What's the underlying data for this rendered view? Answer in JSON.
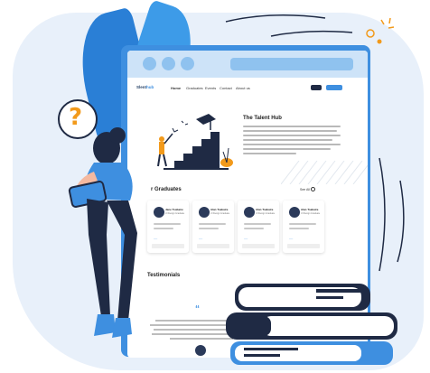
{
  "nav": {
    "logo_main": "Slent",
    "logo_accent": "hub",
    "items": [
      "Home",
      "Graduates",
      "Events",
      "Contact",
      "About us"
    ]
  },
  "hero": {
    "title": "The Talent Hub"
  },
  "graduates": {
    "title_fragment": "r Graduates",
    "see_all": "See All",
    "cards": [
      {
        "name": "Jane Tsabaire",
        "role": "UI Design Graduate"
      },
      {
        "name": "Alan Tsabaire",
        "role": "UI Design Graduate"
      },
      {
        "name": "Alan Tsabaire",
        "role": "UI Design Graduate"
      },
      {
        "name": "Alan Tsabaire",
        "role": "UI Design Graduate"
      }
    ]
  },
  "testimonials": {
    "title": "Testimonials"
  },
  "icons": {
    "question": "?",
    "quote": "“"
  },
  "colors": {
    "accent": "#3e8fe0",
    "dark": "#1f2a44",
    "orange": "#f29a1b"
  }
}
